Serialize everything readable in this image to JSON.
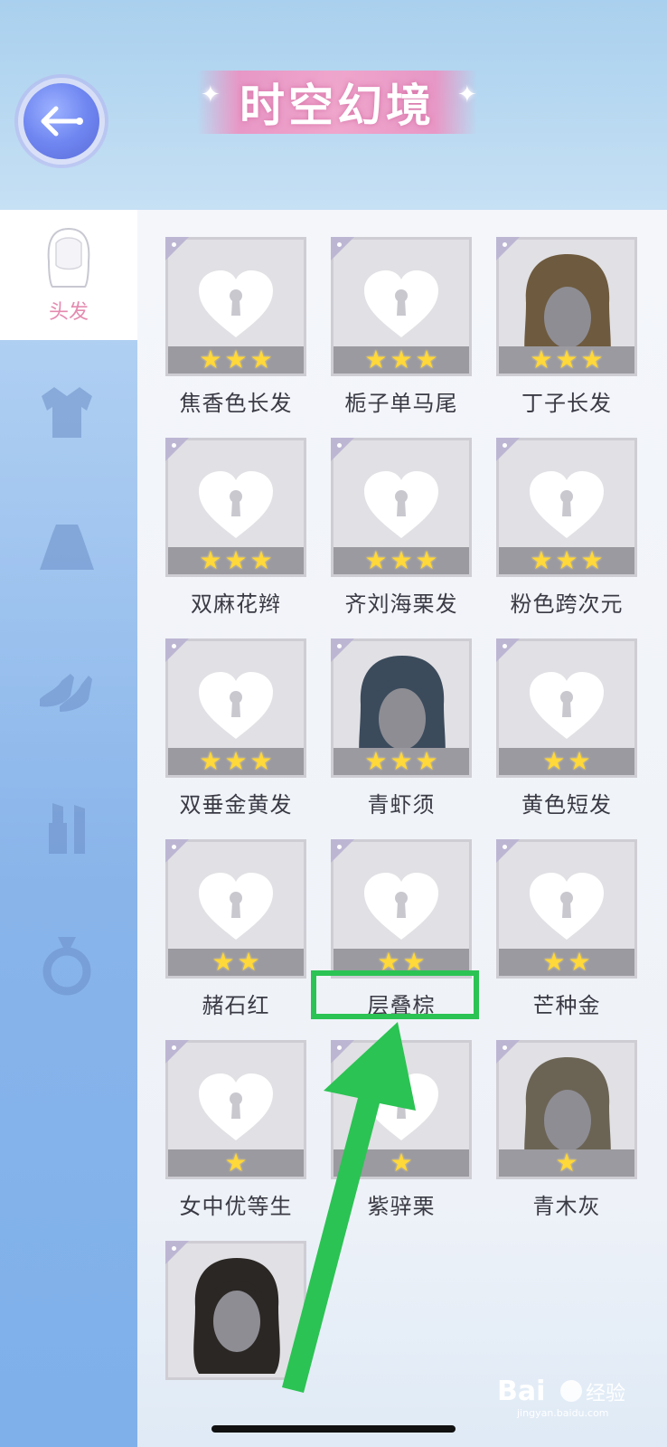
{
  "header": {
    "title": "时空幻境"
  },
  "sidebar": {
    "active_label": "头发",
    "items": [
      {
        "icon": "hair-icon"
      },
      {
        "icon": "jacket-icon"
      },
      {
        "icon": "skirt-icon"
      },
      {
        "icon": "shoes-icon"
      },
      {
        "icon": "lipstick-icon"
      },
      {
        "icon": "ring-icon"
      }
    ]
  },
  "grid": {
    "items": [
      {
        "name": "焦香色长发",
        "stars": 3,
        "unlocked": false
      },
      {
        "name": "栀子单马尾",
        "stars": 3,
        "unlocked": false
      },
      {
        "name": "丁子长发",
        "stars": 3,
        "unlocked": true,
        "hair_color": "#6e5a3e"
      },
      {
        "name": "双麻花辫",
        "stars": 3,
        "unlocked": false
      },
      {
        "name": "齐刘海栗发",
        "stars": 3,
        "unlocked": false
      },
      {
        "name": "粉色跨次元",
        "stars": 3,
        "unlocked": false
      },
      {
        "name": "双垂金黄发",
        "stars": 3,
        "unlocked": false
      },
      {
        "name": "青虾须",
        "stars": 3,
        "unlocked": true,
        "hair_color": "#3b4b5c"
      },
      {
        "name": "黄色短发",
        "stars": 2,
        "unlocked": false
      },
      {
        "name": "赭石红",
        "stars": 2,
        "unlocked": false
      },
      {
        "name": "层叠棕",
        "stars": 2,
        "unlocked": false
      },
      {
        "name": "芒种金",
        "stars": 2,
        "unlocked": false
      },
      {
        "name": "女中优等生",
        "stars": 1,
        "unlocked": false
      },
      {
        "name": "紫骍栗",
        "stars": 1,
        "unlocked": false
      },
      {
        "name": "青木灰",
        "stars": 1,
        "unlocked": true,
        "hair_color": "#6b6455"
      },
      {
        "name": "",
        "stars": 0,
        "unlocked": true,
        "hair_color": "#2b2724"
      }
    ]
  },
  "annotation": {
    "highlight_color": "#2bc353"
  },
  "watermark": {
    "brand": "Bai",
    "brand_suffix": "经验",
    "url": "jingyan.baidu.com"
  }
}
